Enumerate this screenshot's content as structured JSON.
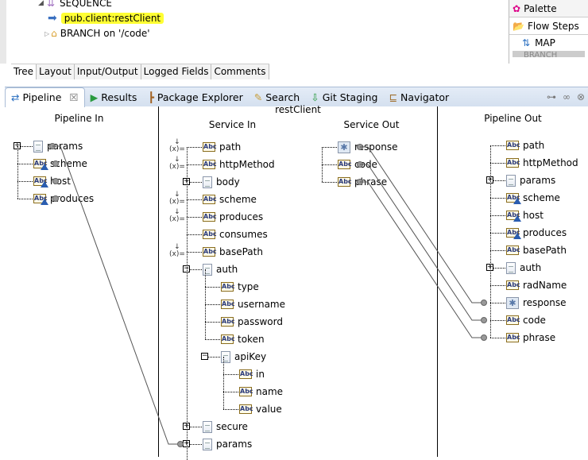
{
  "flow": {
    "items": [
      {
        "label": "SEQUENCE"
      },
      {
        "label": "pub.client:restClient",
        "highlighted": true
      },
      {
        "label": "BRANCH on '/code'"
      }
    ]
  },
  "palette": {
    "title": "Palette",
    "drawer": "Flow Steps",
    "items": [
      "MAP",
      "BRANCH"
    ]
  },
  "editor_tabs": [
    "Tree",
    "Layout",
    "Input/Output",
    "Logged Fields",
    "Comments"
  ],
  "view_tabs": [
    {
      "label": "Pipeline",
      "active": true
    },
    {
      "label": "Results"
    },
    {
      "label": "Package Explorer"
    },
    {
      "label": "Search"
    },
    {
      "label": "Git Staging"
    },
    {
      "label": "Navigator"
    }
  ],
  "pipeline": {
    "pipeline_in_title": "Pipeline In",
    "service_title": "restClient",
    "service_in_title": "Service In",
    "service_out_title": "Service Out",
    "pipeline_out_title": "Pipeline Out",
    "pipeline_in": [
      {
        "label": "params",
        "icon": "document",
        "expand": true
      },
      {
        "label": "scheme",
        "icon": "string-var"
      },
      {
        "label": "host",
        "icon": "string-var"
      },
      {
        "label": "produces",
        "icon": "string-var"
      }
    ],
    "service_in": [
      {
        "label": "path",
        "icon": "string",
        "level": 0,
        "set": true
      },
      {
        "label": "httpMethod",
        "icon": "string",
        "level": 0,
        "set": true
      },
      {
        "label": "body",
        "icon": "document",
        "level": 0,
        "expand": true
      },
      {
        "label": "scheme",
        "icon": "string",
        "level": 0,
        "set": true
      },
      {
        "label": "produces",
        "icon": "string",
        "level": 0,
        "set": true
      },
      {
        "label": "consumes",
        "icon": "string",
        "level": 0
      },
      {
        "label": "basePath",
        "icon": "string",
        "level": 0,
        "set": true
      },
      {
        "label": "auth",
        "icon": "document",
        "level": 0,
        "expand": true,
        "expanded": true
      },
      {
        "label": "type",
        "icon": "string",
        "level": 1
      },
      {
        "label": "username",
        "icon": "string",
        "level": 1
      },
      {
        "label": "password",
        "icon": "string",
        "level": 1
      },
      {
        "label": "token",
        "icon": "string",
        "level": 1
      },
      {
        "label": "apiKey",
        "icon": "document",
        "level": 1,
        "expand": true,
        "expanded": true
      },
      {
        "label": "in",
        "icon": "string",
        "level": 2
      },
      {
        "label": "name",
        "icon": "string",
        "level": 2
      },
      {
        "label": "value",
        "icon": "string",
        "level": 2
      },
      {
        "label": "secure",
        "icon": "document",
        "level": 0,
        "expand": true
      },
      {
        "label": "params",
        "icon": "document",
        "level": 0,
        "expand": true
      }
    ],
    "service_out": [
      {
        "label": "response",
        "icon": "object"
      },
      {
        "label": "code",
        "icon": "string"
      },
      {
        "label": "phrase",
        "icon": "string"
      }
    ],
    "pipeline_out": [
      {
        "label": "path",
        "icon": "string"
      },
      {
        "label": "httpMethod",
        "icon": "string"
      },
      {
        "label": "params",
        "icon": "document",
        "expand": true
      },
      {
        "label": "scheme",
        "icon": "string-var"
      },
      {
        "label": "host",
        "icon": "string-var"
      },
      {
        "label": "produces",
        "icon": "string-var"
      },
      {
        "label": "basePath",
        "icon": "string"
      },
      {
        "label": "auth",
        "icon": "document",
        "expand": true
      },
      {
        "label": "radName",
        "icon": "string"
      },
      {
        "label": "response",
        "icon": "object"
      },
      {
        "label": "code",
        "icon": "string"
      },
      {
        "label": "phrase",
        "icon": "string"
      }
    ],
    "links": [
      {
        "from": "pipeline_in.params",
        "to": "service_in.params"
      },
      {
        "from": "service_out.response",
        "to": "pipeline_out.response"
      },
      {
        "from": "service_out.code",
        "to": "pipeline_out.code"
      },
      {
        "from": "service_out.phrase",
        "to": "pipeline_out.phrase"
      }
    ]
  }
}
